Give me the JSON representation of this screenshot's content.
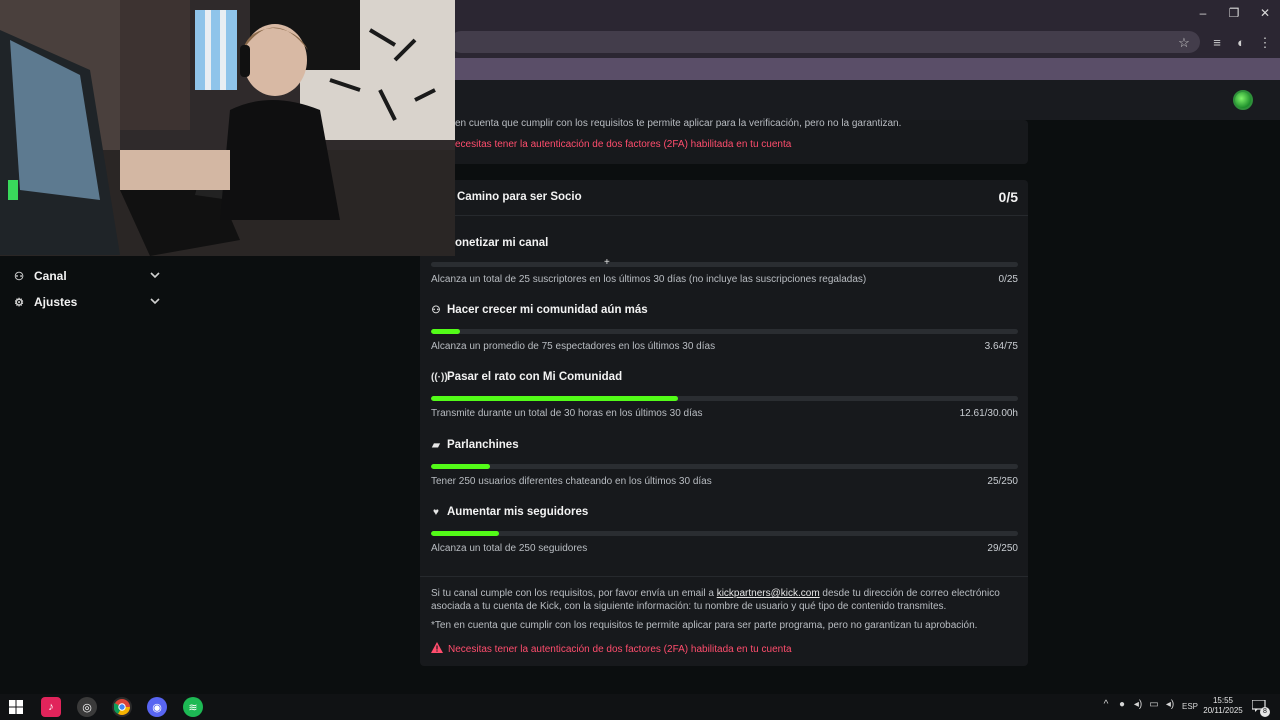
{
  "browser": {
    "win_controls": [
      "–",
      "❐",
      "✕"
    ]
  },
  "sidebar": {
    "items": [
      {
        "label": "Canal"
      },
      {
        "label": "Ajustes"
      }
    ]
  },
  "top_card": {
    "note": "en cuenta que cumplir con los requisitos te permite aplicar para la verificación, pero no la garantizan.",
    "warning": "ecesitas tener la autenticación de dos factores (2FA) habilitada en tu cuenta"
  },
  "socio": {
    "title": "Camino para ser Socio",
    "progress": "0/5",
    "sections": [
      {
        "title": "onetizar mi canal",
        "requirement": "Alcanza un total de 25 suscriptores en los últimos 30 días (no incluye las suscripciones regaladas)",
        "value": "0/25",
        "fill": 0
      },
      {
        "title": "Hacer crecer mi comunidad aún más",
        "requirement": "Alcanza un promedio de 75 espectadores en los últimos 30 días",
        "value": "3.64/75",
        "fill": 0.049
      },
      {
        "title": "Pasar el rato con Mi Comunidad",
        "requirement": "Transmite durante un total de 30 horas en los últimos 30 días",
        "value": "12.61/30.00h",
        "fill": 0.42
      },
      {
        "title": "Parlanchines",
        "requirement": "Tener 250 usuarios diferentes chateando en los últimos 30 días",
        "value": "25/250",
        "fill": 0.1
      },
      {
        "title": "Aumentar mis seguidores",
        "requirement": "Alcanza un total de 250 seguidores",
        "value": "29/250",
        "fill": 0.116
      }
    ],
    "info_pre": "Si tu canal cumple con los requisitos, por favor envía un email a ",
    "email": "kickpartners@kick.com",
    "info_post": " desde tu dirección de correo electrónico",
    "info_line2": "asociada a tu cuenta de Kick, con la siguiente información: tu nombre de usuario y qué tipo de contenido transmites.",
    "footnote": "*Ten en cuenta que cumplir con los requisitos te permite aplicar para ser parte programa, pero no garantizan tu aprobación.",
    "warning": "Necesitas tener la autenticación de dos factores (2FA) habilitada en tu cuenta"
  },
  "taskbar": {
    "language": "ESP",
    "time": "15:55",
    "date": "20/11/2025",
    "notifications": "8"
  },
  "colors": {
    "accent": "#53fc18",
    "warning": "#ff4d6d"
  }
}
